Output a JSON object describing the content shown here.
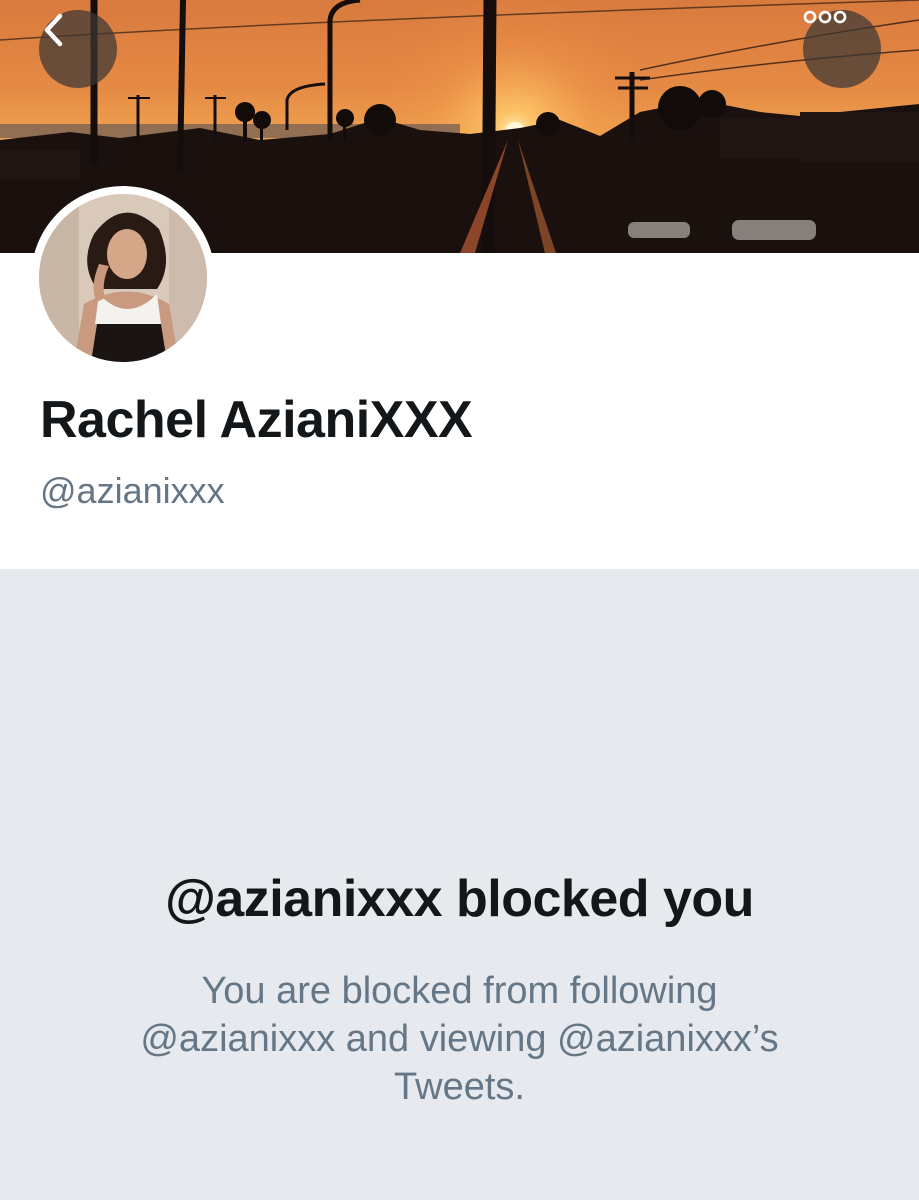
{
  "header": {
    "back_icon": "chevron-left-icon",
    "more_icon": "ellipsis-icon",
    "banner_description": "sunset-cityscape",
    "colors": {
      "sky_top": "#d97a3e",
      "sun_glow": "#f0a350",
      "silhouette": "#140d0c",
      "button_bg": "#3c3734"
    }
  },
  "profile": {
    "display_name": "Rachel AzianiXXX",
    "handle": "@azianixxx"
  },
  "blocked_notice": {
    "title": "@azianixxx blocked you",
    "description_lines": [
      "You are blocked from following",
      "@azianixxx and viewing @azianixxx’s",
      "Tweets."
    ]
  },
  "colors": {
    "primary_text": "#14171a",
    "secondary_text": "#657786",
    "panel_bg": "#e6e9ee",
    "card_bg": "#ffffff"
  }
}
